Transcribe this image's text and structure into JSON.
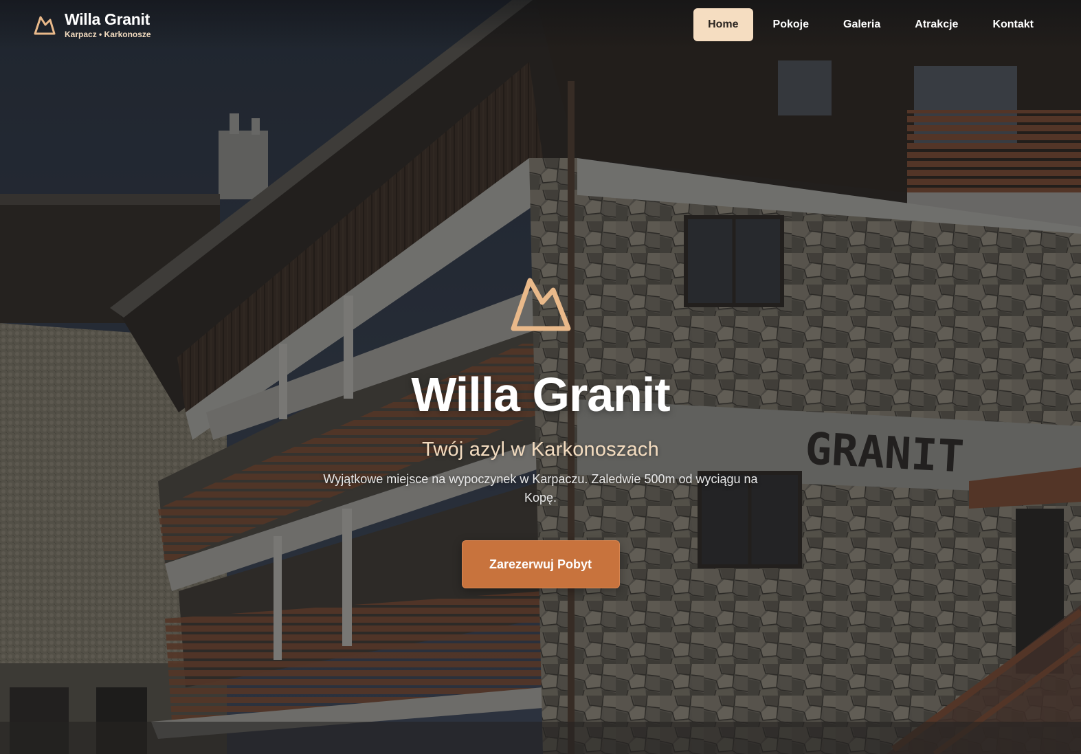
{
  "header": {
    "brand_title": "Willa Granit",
    "brand_subtitle": "Karpacz • Karkonosze",
    "logo_icon": "mountain-icon"
  },
  "nav": {
    "items": [
      {
        "label": "Home",
        "active": true
      },
      {
        "label": "Pokoje",
        "active": false
      },
      {
        "label": "Galeria",
        "active": false
      },
      {
        "label": "Atrakcje",
        "active": false
      },
      {
        "label": "Kontakt",
        "active": false
      }
    ]
  },
  "hero": {
    "logo_icon": "mountain-icon",
    "title": "Willa Granit",
    "tagline": "Twój azyl w Karkonoszach",
    "description": "Wyjątkowe miejsce na wypoczynek w Karpaczu. Zaledwie 500m od wyciągu na Kopę.",
    "cta_label": "Zarezerwuj Pobyt",
    "building_sign": "GRANIT"
  },
  "colors": {
    "accent": "#c8733d",
    "nav_active_bg": "#f5ddc1",
    "logo_color": "#e9b98a",
    "tagline_color": "#f3dcc0"
  }
}
